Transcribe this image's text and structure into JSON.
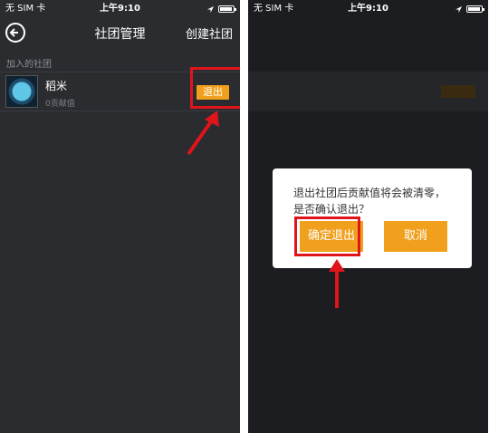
{
  "left": {
    "status": {
      "carrier": "无 SIM 卡",
      "time": "上午9:10"
    },
    "nav": {
      "title": "社团管理",
      "action": "创建社团"
    },
    "section_label": "加入的社团",
    "club": {
      "name": "稻米",
      "subtitle": "0贡献值",
      "quit_label": "退出"
    }
  },
  "right": {
    "status": {
      "carrier": "无 SIM 卡",
      "time": "上午9:10"
    },
    "dialog": {
      "message": "退出社团后贡献值将会被清零，是否确认退出？",
      "confirm_label": "确定退出",
      "cancel_label": "取消"
    }
  },
  "colors": {
    "accent": "#f0a01c",
    "highlight": "#e0141b",
    "background": "#2b2c30"
  }
}
